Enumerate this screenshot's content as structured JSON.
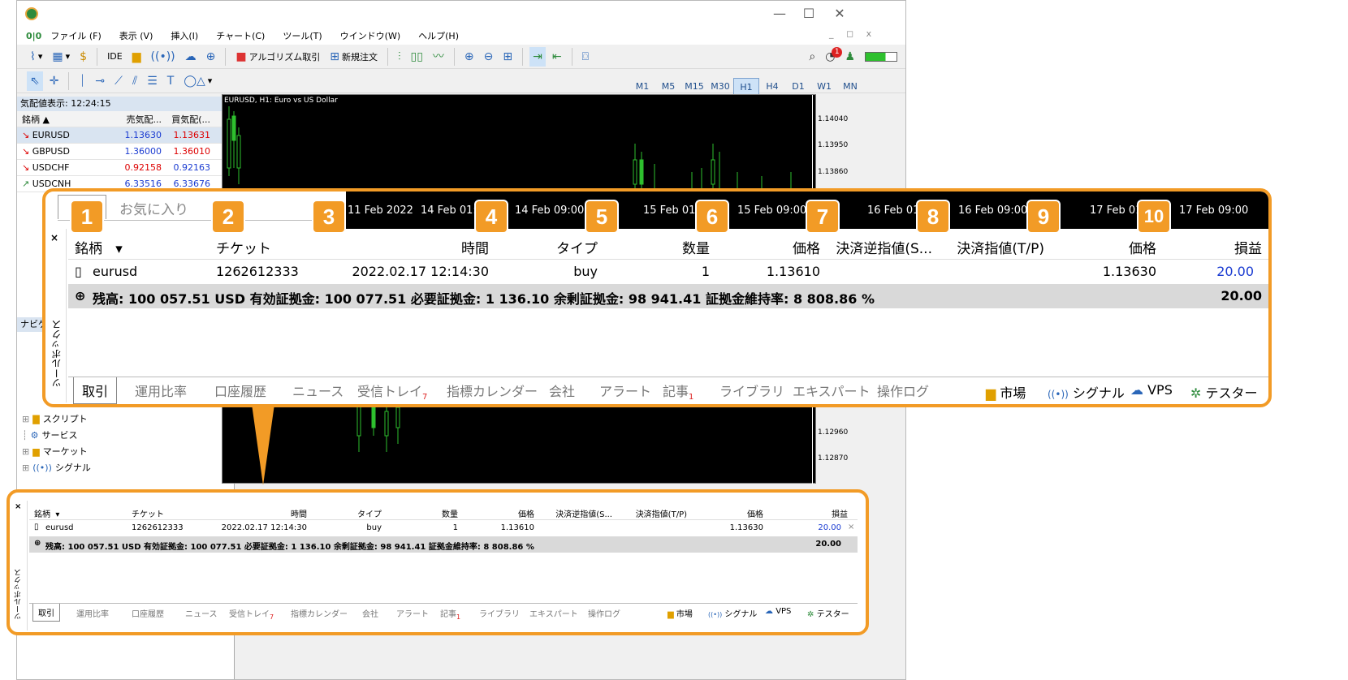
{
  "menu": [
    "ファイル (F)",
    "表示 (V)",
    "挿入(I)",
    "チャート(C)",
    "ツール(T)",
    "ウインドウ(W)",
    "ヘルプ(H)"
  ],
  "toolbar1": [
    "IDE",
    "アルゴリズム取引",
    "新規注文"
  ],
  "timeframes": [
    "M1",
    "M5",
    "M15",
    "M30",
    "H1",
    "H4",
    "D1",
    "W1",
    "MN"
  ],
  "timeframe_selected": "H1",
  "notification_count": "1",
  "market_watch": {
    "header": "気配値表示: 12:24:15",
    "col_symbol": "銘柄",
    "col_bid": "売気配...",
    "col_ask": "買気配(...",
    "rows": [
      {
        "symbol": "EURUSD",
        "bid": "1.13630",
        "ask": "1.13631"
      },
      {
        "symbol": "GBPUSD",
        "bid": "1.36000",
        "ask": "1.36010"
      },
      {
        "symbol": "USDCHF",
        "bid": "0.92158",
        "ask": "0.92163"
      },
      {
        "symbol": "USDCNH",
        "bid": "6.33516",
        "ask": "6.33676"
      }
    ]
  },
  "navigator": {
    "header": "ナビゲ",
    "items": [
      "スクリプト",
      "サービス",
      "マーケット",
      "シグナル"
    ]
  },
  "chart": {
    "title": "EURUSD, H1:  Euro vs US Dollar",
    "prices_top": [
      "1.14040",
      "1.13950",
      "1.13860"
    ],
    "prices_bottom": [
      "1.12960",
      "1.12870"
    ],
    "dates": [
      "11 Feb 2022",
      "14 Feb 01:00",
      "14 Feb 09:00",
      "15 Feb 01:00",
      "15 Feb 09:00",
      "16 Feb 01:00",
      "16 Feb 09:00",
      "17 Feb 01:00",
      "17 Feb 09:00"
    ]
  },
  "favorites_tab": "お気に入り",
  "toolbox": {
    "side_label": "ツールボックス",
    "columns": [
      "銘柄",
      "チケット",
      "時間",
      "タイプ",
      "数量",
      "価格",
      "決済逆指値(S...",
      "決済指値(T/P)",
      "価格",
      "損益"
    ],
    "row": {
      "symbol": "eurusd",
      "ticket": "1262612333",
      "time": "2022.02.17 12:14:30",
      "type": "buy",
      "volume": "1",
      "price_open": "1.13610",
      "sl": "",
      "tp": "",
      "price_current": "1.13630",
      "profit": "20.00"
    },
    "balance": "残高: 100 057.51 USD  有効証拠金: 100 077.51  必要証拠金: 1 136.10  余剰証拠金: 98 941.41  証拠金維持率: 8 808.86 %",
    "balance_profit": "20.00",
    "tabs": [
      "取引",
      "運用比率",
      "口座履歴",
      "ニュース",
      "受信トレイ",
      "指標カレンダー",
      "会社",
      "アラート",
      "記事",
      "ライブラリ",
      "エキスパート",
      "操作ログ"
    ],
    "inbox_count": "7",
    "articles_count": "1",
    "right_tabs": [
      "市場",
      "シグナル",
      "VPS",
      "テスター"
    ]
  },
  "badges": [
    "1",
    "2",
    "3",
    "4",
    "5",
    "6",
    "7",
    "8",
    "9",
    "10"
  ],
  "colors": {
    "accent": "#f29b26",
    "profit": "#1a3bd1"
  }
}
